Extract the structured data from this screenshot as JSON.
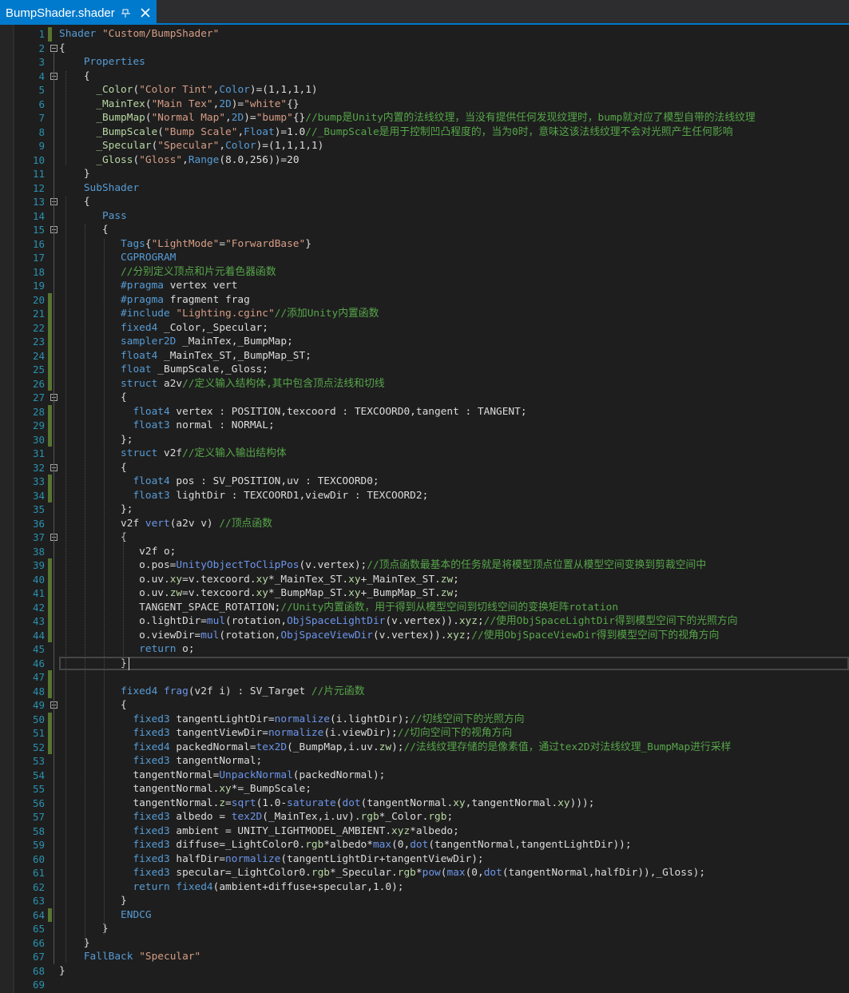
{
  "tab": {
    "title": "BumpShader.shader",
    "pin_icon": "pin-icon",
    "close_icon": "close-icon"
  },
  "colors": {
    "keyword": "#569cd6",
    "type": "#4ec9b0",
    "string": "#d69d85",
    "comment": "#57a64a",
    "property": "#b8d7a3",
    "function": "#6c95eb",
    "plain": "#dcdcdc",
    "preprocessor": "#9b9b9b",
    "line_number": "#2b91af",
    "change_mark": "#577430"
  },
  "editor": {
    "line_numbers": [
      "1",
      "2",
      "3",
      "4",
      "5",
      "6",
      "7",
      "8",
      "9",
      "10",
      "11",
      "12",
      "13",
      "14",
      "15",
      "16",
      "17",
      "18",
      "19",
      "20",
      "21",
      "22",
      "23",
      "24",
      "25",
      "26",
      "27",
      "28",
      "29",
      "30",
      "31",
      "32",
      "33",
      "34",
      "35",
      "36",
      "37",
      "38",
      "39",
      "40",
      "41",
      "42",
      "43",
      "44",
      "45",
      "46",
      "47",
      "48",
      "49",
      "50",
      "51",
      "52",
      "53",
      "54",
      "55",
      "56",
      "57",
      "58",
      "59",
      "60",
      "61",
      "62",
      "63",
      "64",
      "65",
      "66",
      "67",
      "68",
      "69"
    ],
    "lines": [
      [
        [
          "k",
          "Shader"
        ],
        [
          "p",
          " "
        ],
        [
          "s",
          "\"Custom/BumpShader\""
        ]
      ],
      [
        [
          "p",
          "{"
        ]
      ],
      [
        [
          "p",
          "    "
        ],
        [
          "k",
          "Properties"
        ]
      ],
      [
        [
          "p",
          "    {"
        ]
      ],
      [
        [
          "p",
          "      "
        ],
        [
          "v",
          "_Color"
        ],
        [
          "p",
          "("
        ],
        [
          "s",
          "\"Color Tint\""
        ],
        [
          "p",
          ","
        ],
        [
          "k",
          "Color"
        ],
        [
          "p",
          ")=(1,1,1,1)"
        ]
      ],
      [
        [
          "p",
          "      "
        ],
        [
          "v",
          "_MainTex"
        ],
        [
          "p",
          "("
        ],
        [
          "s",
          "\"Main Tex\""
        ],
        [
          "p",
          ","
        ],
        [
          "k",
          "2D"
        ],
        [
          "p",
          ")="
        ],
        [
          "s",
          "\"white\""
        ],
        [
          "p",
          "{}"
        ]
      ],
      [
        [
          "p",
          "      "
        ],
        [
          "v",
          "_BumpMap"
        ],
        [
          "p",
          "("
        ],
        [
          "s",
          "\"Normal Map\""
        ],
        [
          "p",
          ","
        ],
        [
          "k",
          "2D"
        ],
        [
          "p",
          ")="
        ],
        [
          "s",
          "\"bump\""
        ],
        [
          "p",
          "{}"
        ],
        [
          "c",
          "//bump是Unity内置的法线纹理，当没有提供任何发现纹理时，bump就对应了模型自带的法线纹理"
        ]
      ],
      [
        [
          "p",
          "      "
        ],
        [
          "v",
          "_BumpScale"
        ],
        [
          "p",
          "("
        ],
        [
          "s",
          "\"Bump Scale\""
        ],
        [
          "p",
          ","
        ],
        [
          "k",
          "Float"
        ],
        [
          "p",
          ")=1.0"
        ],
        [
          "c",
          "//_BumpScale是用于控制凹凸程度的，当为0时，意味这该法线纹理不会对光照产生任何影响"
        ]
      ],
      [
        [
          "p",
          "      "
        ],
        [
          "v",
          "_Specular"
        ],
        [
          "p",
          "("
        ],
        [
          "s",
          "\"Specular\""
        ],
        [
          "p",
          ","
        ],
        [
          "k",
          "Color"
        ],
        [
          "p",
          ")=(1,1,1,1)"
        ]
      ],
      [
        [
          "p",
          "      "
        ],
        [
          "v",
          "_Gloss"
        ],
        [
          "p",
          "("
        ],
        [
          "s",
          "\"Gloss\""
        ],
        [
          "p",
          ","
        ],
        [
          "k",
          "Range"
        ],
        [
          "p",
          "(8.0,256))=20"
        ]
      ],
      [
        [
          "p",
          "    }"
        ]
      ],
      [
        [
          "p",
          "    "
        ],
        [
          "k",
          "SubShader"
        ]
      ],
      [
        [
          "p",
          "    {"
        ]
      ],
      [
        [
          "p",
          "       "
        ],
        [
          "k",
          "Pass"
        ]
      ],
      [
        [
          "p",
          "       {"
        ]
      ],
      [
        [
          "p",
          "          "
        ],
        [
          "k",
          "Tags"
        ],
        [
          "p",
          "{"
        ],
        [
          "s",
          "\"LightMode\""
        ],
        [
          "p",
          "="
        ],
        [
          "s",
          "\"ForwardBase\""
        ],
        [
          "p",
          "}"
        ]
      ],
      [
        [
          "p",
          "          "
        ],
        [
          "k",
          "CGPROGRAM"
        ]
      ],
      [
        [
          "p",
          "          "
        ],
        [
          "c",
          "//分别定义顶点和片元着色器函数"
        ]
      ],
      [
        [
          "p",
          "          "
        ],
        [
          "k",
          "#pragma"
        ],
        [
          "p",
          " vertex vert"
        ]
      ],
      [
        [
          "p",
          "          "
        ],
        [
          "k",
          "#pragma"
        ],
        [
          "p",
          " fragment frag"
        ]
      ],
      [
        [
          "p",
          "          "
        ],
        [
          "k",
          "#include"
        ],
        [
          "p",
          " "
        ],
        [
          "s",
          "\"Lighting.cginc\""
        ],
        [
          "c",
          "//添加Unity内置函数"
        ]
      ],
      [
        [
          "p",
          "          "
        ],
        [
          "k",
          "fixed4"
        ],
        [
          "p",
          " _Color,_Specular;"
        ]
      ],
      [
        [
          "p",
          "          "
        ],
        [
          "k",
          "sampler2D"
        ],
        [
          "p",
          " _MainTex,_BumpMap;"
        ]
      ],
      [
        [
          "p",
          "          "
        ],
        [
          "k",
          "float4"
        ],
        [
          "p",
          " _MainTex_ST,_BumpMap_ST;"
        ]
      ],
      [
        [
          "p",
          "          "
        ],
        [
          "k",
          "float"
        ],
        [
          "p",
          " _BumpScale,_Gloss;"
        ]
      ],
      [
        [
          "p",
          "          "
        ],
        [
          "k",
          "struct"
        ],
        [
          "p",
          " a2v"
        ],
        [
          "c",
          "//定义输入结构体,其中包含顶点法线和切线"
        ]
      ],
      [
        [
          "p",
          "          {"
        ]
      ],
      [
        [
          "p",
          "            "
        ],
        [
          "k",
          "float4"
        ],
        [
          "p",
          " vertex : POSITION,texcoord : TEXCOORD0,tangent : TANGENT;"
        ]
      ],
      [
        [
          "p",
          "            "
        ],
        [
          "k",
          "float3"
        ],
        [
          "p",
          " normal : NORMAL;"
        ]
      ],
      [
        [
          "p",
          "          };"
        ]
      ],
      [
        [
          "p",
          "          "
        ],
        [
          "k",
          "struct"
        ],
        [
          "p",
          " v2f"
        ],
        [
          "c",
          "//定义输入输出结构体"
        ]
      ],
      [
        [
          "p",
          "          {"
        ]
      ],
      [
        [
          "p",
          "            "
        ],
        [
          "k",
          "float4"
        ],
        [
          "p",
          " pos : SV_POSITION,uv : TEXCOORD0;"
        ]
      ],
      [
        [
          "p",
          "            "
        ],
        [
          "k",
          "float3"
        ],
        [
          "p",
          " lightDir : TEXCOORD1,viewDir : TEXCOORD2;"
        ]
      ],
      [
        [
          "p",
          "          };"
        ]
      ],
      [
        [
          "p",
          "          v2f "
        ],
        [
          "f",
          "vert"
        ],
        [
          "p",
          "(a2v v) "
        ],
        [
          "c",
          "//顶点函数"
        ]
      ],
      [
        [
          "p",
          "          {"
        ]
      ],
      [
        [
          "p",
          "             v2f o;"
        ]
      ],
      [
        [
          "p",
          "             o.pos="
        ],
        [
          "f",
          "UnityObjectToClipPos"
        ],
        [
          "p",
          "(v.vertex);"
        ],
        [
          "c",
          "//顶点函数最基本的任务就是将模型顶点位置从模型空间变换到剪裁空间中"
        ]
      ],
      [
        [
          "p",
          "             o.uv."
        ],
        [
          "v",
          "xy"
        ],
        [
          "p",
          "=v.texcoord."
        ],
        [
          "v",
          "xy"
        ],
        [
          "p",
          "*_MainTex_ST."
        ],
        [
          "v",
          "xy"
        ],
        [
          "p",
          "+_MainTex_ST."
        ],
        [
          "v",
          "zw"
        ],
        [
          "p",
          ";"
        ]
      ],
      [
        [
          "p",
          "             o.uv."
        ],
        [
          "v",
          "zw"
        ],
        [
          "p",
          "=v.texcoord."
        ],
        [
          "v",
          "xy"
        ],
        [
          "p",
          "*_BumpMap_ST."
        ],
        [
          "v",
          "xy"
        ],
        [
          "p",
          "+_BumpMap_ST."
        ],
        [
          "v",
          "zw"
        ],
        [
          "p",
          ";"
        ]
      ],
      [
        [
          "p",
          "             TANGENT_SPACE_ROTATION;"
        ],
        [
          "c",
          "//Unity内置函数，用于得到从模型空间到切线空间的变换矩阵rotation"
        ]
      ],
      [
        [
          "p",
          "             o.lightDir="
        ],
        [
          "f",
          "mul"
        ],
        [
          "p",
          "(rotation,"
        ],
        [
          "f",
          "ObjSpaceLightDir"
        ],
        [
          "p",
          "(v.vertex))."
        ],
        [
          "v",
          "xyz"
        ],
        [
          "p",
          ";"
        ],
        [
          "c",
          "//使用ObjSpaceLightDir得到模型空间下的光照方向"
        ]
      ],
      [
        [
          "p",
          "             o.viewDir="
        ],
        [
          "f",
          "mul"
        ],
        [
          "p",
          "(rotation,"
        ],
        [
          "f",
          "ObjSpaceViewDir"
        ],
        [
          "p",
          "(v.vertex))."
        ],
        [
          "v",
          "xyz"
        ],
        [
          "p",
          ";"
        ],
        [
          "c",
          "//使用ObjSpaceViewDir得到模型空间下的视角方向"
        ]
      ],
      [
        [
          "p",
          "             "
        ],
        [
          "k",
          "return"
        ],
        [
          "p",
          " o;"
        ]
      ],
      [
        [
          "p",
          "          }"
        ]
      ],
      [
        [
          "p",
          ""
        ]
      ],
      [
        [
          "p",
          "          "
        ],
        [
          "k",
          "fixed4"
        ],
        [
          "p",
          " "
        ],
        [
          "f",
          "frag"
        ],
        [
          "p",
          "(v2f i) : SV_Target "
        ],
        [
          "c",
          "//片元函数"
        ]
      ],
      [
        [
          "p",
          "          {"
        ]
      ],
      [
        [
          "p",
          "            "
        ],
        [
          "k",
          "fixed3"
        ],
        [
          "p",
          " tangentLightDir="
        ],
        [
          "f",
          "normalize"
        ],
        [
          "p",
          "(i.lightDir);"
        ],
        [
          "c",
          "//切线空间下的光照方向"
        ]
      ],
      [
        [
          "p",
          "            "
        ],
        [
          "k",
          "fixed3"
        ],
        [
          "p",
          " tangentViewDir="
        ],
        [
          "f",
          "normalize"
        ],
        [
          "p",
          "(i.viewDir);"
        ],
        [
          "c",
          "//切向空间下的视角方向"
        ]
      ],
      [
        [
          "p",
          "            "
        ],
        [
          "k",
          "fixed4"
        ],
        [
          "p",
          " packedNormal="
        ],
        [
          "f",
          "tex2D"
        ],
        [
          "p",
          "(_BumpMap,i.uv."
        ],
        [
          "v",
          "zw"
        ],
        [
          "p",
          ");"
        ],
        [
          "c",
          "//法线纹理存储的是像素值，通过tex2D对法线纹理_BumpMap进行采样"
        ]
      ],
      [
        [
          "p",
          "            "
        ],
        [
          "k",
          "fixed3"
        ],
        [
          "p",
          " tangentNormal;"
        ]
      ],
      [
        [
          "p",
          "            tangentNormal="
        ],
        [
          "f",
          "UnpackNormal"
        ],
        [
          "p",
          "(packedNormal);"
        ]
      ],
      [
        [
          "p",
          "            tangentNormal."
        ],
        [
          "v",
          "xy"
        ],
        [
          "p",
          "*=_BumpScale;"
        ]
      ],
      [
        [
          "p",
          "            tangentNormal."
        ],
        [
          "v",
          "z"
        ],
        [
          "p",
          "="
        ],
        [
          "f",
          "sqrt"
        ],
        [
          "p",
          "(1.0-"
        ],
        [
          "f",
          "saturate"
        ],
        [
          "p",
          "("
        ],
        [
          "f",
          "dot"
        ],
        [
          "p",
          "(tangentNormal."
        ],
        [
          "v",
          "xy"
        ],
        [
          "p",
          ",tangentNormal."
        ],
        [
          "v",
          "xy"
        ],
        [
          "p",
          ")));"
        ]
      ],
      [
        [
          "p",
          "            "
        ],
        [
          "k",
          "fixed3"
        ],
        [
          "p",
          " albedo = "
        ],
        [
          "f",
          "tex2D"
        ],
        [
          "p",
          "(_MainTex,i.uv)."
        ],
        [
          "v",
          "rgb"
        ],
        [
          "p",
          "*_Color."
        ],
        [
          "v",
          "rgb"
        ],
        [
          "p",
          ";"
        ]
      ],
      [
        [
          "p",
          "            "
        ],
        [
          "k",
          "fixed3"
        ],
        [
          "p",
          " ambient = UNITY_LIGHTMODEL_AMBIENT."
        ],
        [
          "v",
          "xyz"
        ],
        [
          "p",
          "*albedo;"
        ]
      ],
      [
        [
          "p",
          "            "
        ],
        [
          "k",
          "fixed3"
        ],
        [
          "p",
          " diffuse=_LightColor0."
        ],
        [
          "v",
          "rgb"
        ],
        [
          "p",
          "*albedo*"
        ],
        [
          "f",
          "max"
        ],
        [
          "p",
          "(0,"
        ],
        [
          "f",
          "dot"
        ],
        [
          "p",
          "(tangentNormal,tangentLightDir));"
        ]
      ],
      [
        [
          "p",
          "            "
        ],
        [
          "k",
          "fixed3"
        ],
        [
          "p",
          " halfDir="
        ],
        [
          "f",
          "normalize"
        ],
        [
          "p",
          "(tangentLightDir+tangentViewDir);"
        ]
      ],
      [
        [
          "p",
          "            "
        ],
        [
          "k",
          "fixed3"
        ],
        [
          "p",
          " specular=_LightColor0."
        ],
        [
          "v",
          "rgb"
        ],
        [
          "p",
          "*_Specular."
        ],
        [
          "v",
          "rgb"
        ],
        [
          "p",
          "*"
        ],
        [
          "f",
          "pow"
        ],
        [
          "p",
          "("
        ],
        [
          "f",
          "max"
        ],
        [
          "p",
          "(0,"
        ],
        [
          "f",
          "dot"
        ],
        [
          "p",
          "(tangentNormal,halfDir)),_Gloss);"
        ]
      ],
      [
        [
          "p",
          "            "
        ],
        [
          "k",
          "return"
        ],
        [
          "p",
          " "
        ],
        [
          "k",
          "fixed4"
        ],
        [
          "p",
          "(ambient+diffuse+specular,1.0);"
        ]
      ],
      [
        [
          "p",
          "          }"
        ]
      ],
      [
        [
          "p",
          "          "
        ],
        [
          "k",
          "ENDCG"
        ]
      ],
      [
        [
          "p",
          "       }"
        ]
      ],
      [
        [
          "p",
          "    }"
        ]
      ],
      [
        [
          "p",
          "    "
        ],
        [
          "k",
          "FallBack"
        ],
        [
          "p",
          " "
        ],
        [
          "s",
          "\"Specular\""
        ]
      ],
      [
        [
          "p",
          "}"
        ]
      ],
      [
        [
          "p",
          ""
        ]
      ]
    ],
    "changed_lines": [
      1,
      20,
      21,
      22,
      23,
      24,
      25,
      26,
      28,
      29,
      30,
      33,
      34,
      39,
      40,
      41,
      42,
      43,
      44,
      47,
      48,
      50,
      51,
      52,
      64
    ],
    "fold_lines": [
      2,
      4,
      13,
      15,
      27,
      32,
      37,
      49
    ],
    "current_line": 46
  }
}
